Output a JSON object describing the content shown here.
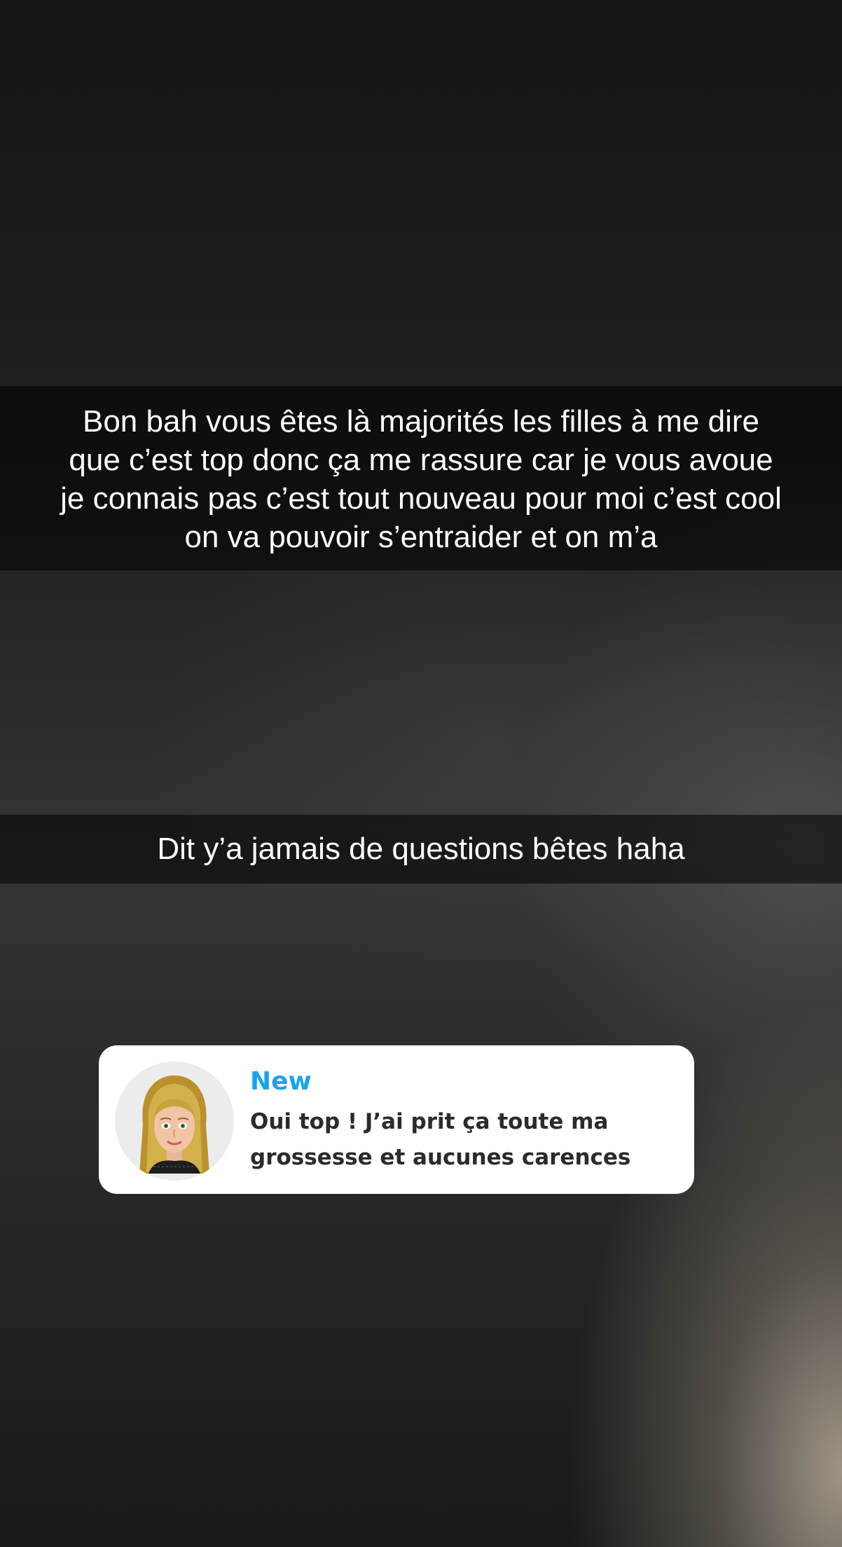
{
  "captions": [
    {
      "lines": [
        "Bon bah vous êtes là majorités les filles à me dire",
        "que c’est top donc ça me rassure car je vous avoue",
        "je connais pas c’est tout nouveau pour moi c’est cool",
        "on va pouvoir s’entraider et on m’a"
      ]
    },
    {
      "text": "Dit y’a jamais de questions bêtes haha"
    }
  ],
  "notification": {
    "title": "New",
    "message_lines": [
      "Oui top ! J’ai prit ça toute ma",
      "grossesse et aucunes carences"
    ],
    "avatar_icon": "bitmoji-avatar-icon",
    "title_color": "#1aa3e8"
  }
}
